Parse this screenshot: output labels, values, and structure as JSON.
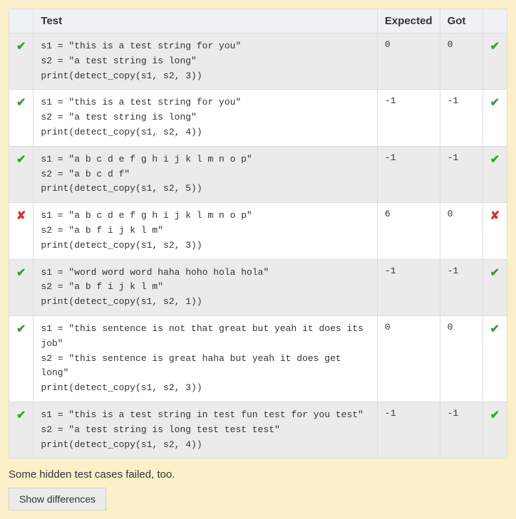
{
  "columns": {
    "test": "Test",
    "expected": "Expected",
    "got": "Got"
  },
  "rows": [
    {
      "pass": true,
      "code": "s1 = \"this is a test string for you\"\ns2 = \"a test string is long\"\nprint(detect_copy(s1, s2, 3))",
      "expected": "0",
      "got": "0"
    },
    {
      "pass": true,
      "code": "s1 = \"this is a test string for you\"\ns2 = \"a test string is long\"\nprint(detect_copy(s1, s2, 4))",
      "expected": "-1",
      "got": "-1"
    },
    {
      "pass": true,
      "code": "s1 = \"a b c d e f g h i j k l m n o p\"\ns2 = \"a b c d f\"\nprint(detect_copy(s1, s2, 5))",
      "expected": "-1",
      "got": "-1"
    },
    {
      "pass": false,
      "code": "s1 = \"a b c d e f g h i j k l m n o p\"\ns2 = \"a b f i j k l m\"\nprint(detect_copy(s1, s2, 3))",
      "expected": "6",
      "got": "0"
    },
    {
      "pass": true,
      "code": "s1 = \"word word word haha hoho hola hola\"\ns2 = \"a b f i j k l m\"\nprint(detect_copy(s1, s2, 1))",
      "expected": "-1",
      "got": "-1"
    },
    {
      "pass": true,
      "code": "s1 = \"this sentence is not that great but yeah it does its job\"\ns2 = \"this sentence is great haha but yeah it does get long\"\nprint(detect_copy(s1, s2, 3))",
      "expected": "0",
      "got": "0"
    },
    {
      "pass": true,
      "code": "s1 = \"this is a test string in test fun test for you test\"\ns2 = \"a test string is long test test test\"\nprint(detect_copy(s1, s2, 4))",
      "expected": "-1",
      "got": "-1"
    }
  ],
  "footer_note": "Some hidden test cases failed, too.",
  "show_diff_button": "Show differences",
  "icons": {
    "pass_glyph": "✔",
    "fail_glyph": "✘"
  }
}
